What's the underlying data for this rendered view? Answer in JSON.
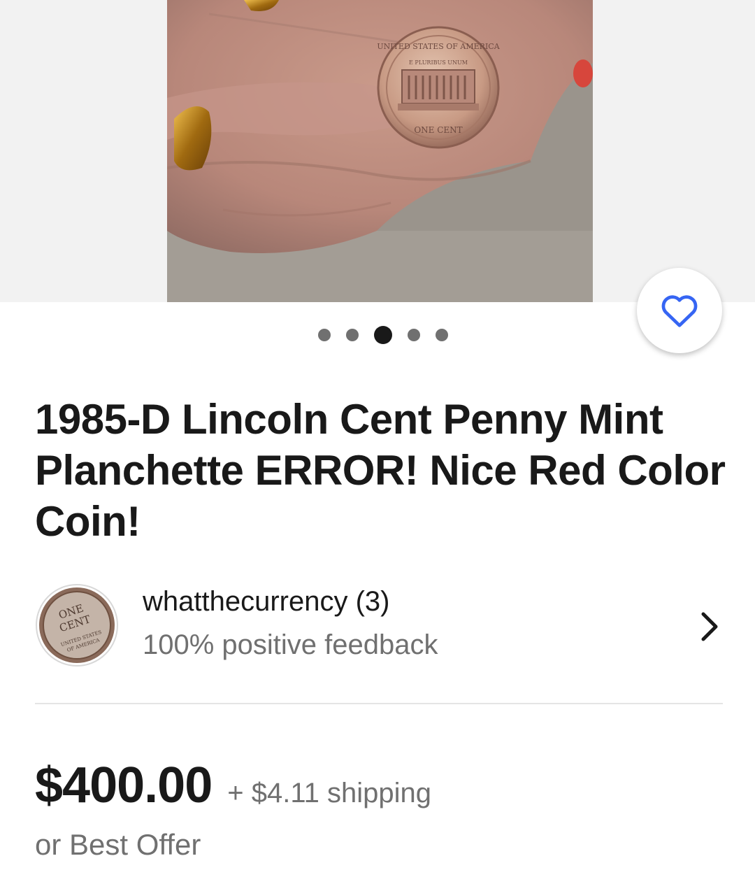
{
  "listing": {
    "title": "1985-D Lincoln Cent Penny Mint Planchette ERROR! Nice Red Color Coin!",
    "gallery": {
      "image_count": 5,
      "active_index": 2,
      "coin_text_top": "UNITED STATES OF AMERICA",
      "coin_text_motto": "E PLURIBUS UNUM",
      "coin_text_bottom": "ONE CENT"
    },
    "favorite_icon": "heart-icon"
  },
  "seller": {
    "name": "whatthecurrency (3)",
    "feedback": "100% positive feedback",
    "avatar_text": "ONE CENT",
    "avatar_subtext": "UNITED STATES OF AMERICA",
    "chevron_icon": "chevron-right-icon"
  },
  "pricing": {
    "price": "$400.00",
    "shipping": "+ $4.11 shipping",
    "best_offer": "or Best Offer"
  },
  "colors": {
    "accent": "#3665f3",
    "text_primary": "#191919",
    "text_secondary": "#707070",
    "gallery_bg": "#f2f2f2"
  }
}
